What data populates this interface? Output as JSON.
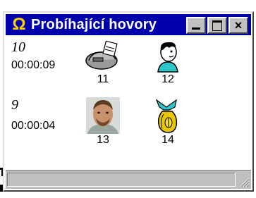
{
  "window": {
    "title": "Probíhající hovory",
    "icon": "omega-icon",
    "icon_glyph": "Ω",
    "controls": [
      "minimize",
      "maximize",
      "close"
    ],
    "close_glyph": "×"
  },
  "lines": [
    {
      "line": "10",
      "duration": "00:00:09",
      "parties": [
        {
          "id": "11",
          "icon": "fax-icon"
        },
        {
          "id": "12",
          "icon": "person-cartoon-icon"
        }
      ]
    },
    {
      "line": "9",
      "duration": "00:00:04",
      "parties": [
        {
          "id": "13",
          "icon": "person-photo-icon"
        },
        {
          "id": "14",
          "icon": "moneybag-icon"
        }
      ]
    }
  ],
  "colors": {
    "titlebar": "#0000aa",
    "chrome": "#c0c0c0",
    "app_icon": "#ffd200"
  }
}
